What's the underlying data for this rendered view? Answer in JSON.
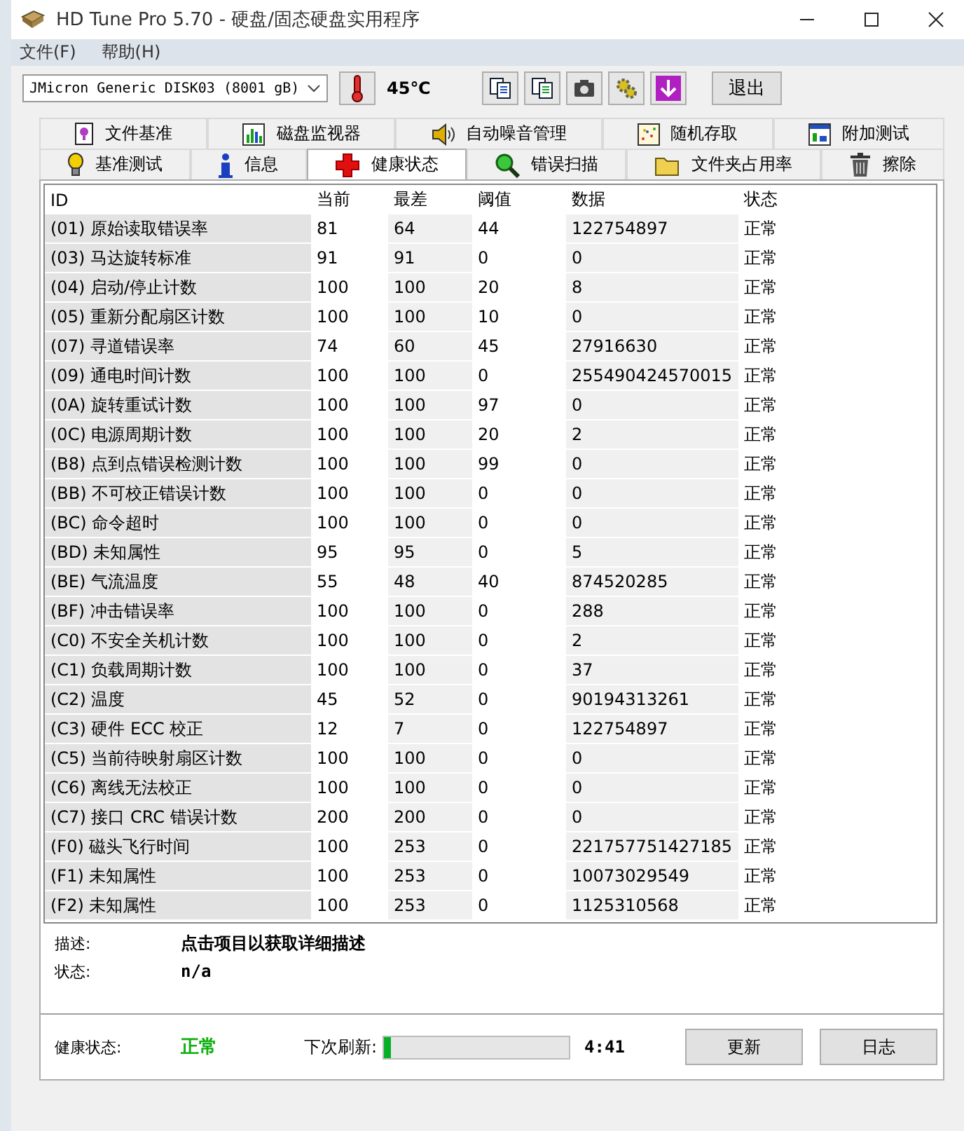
{
  "window": {
    "title": "HD Tune Pro 5.70 - 硬盘/固态硬盘实用程序"
  },
  "menu": [
    "文件(F)",
    "帮助(H)"
  ],
  "toolbar": {
    "drive": "JMicron Generic DISK03 (8001 gB)",
    "temperature": "45℃",
    "exit_button": "退出"
  },
  "tabs_top": [
    {
      "label": "文件基准",
      "selected": false
    },
    {
      "label": "磁盘监视器",
      "selected": false
    },
    {
      "label": "自动噪音管理",
      "selected": false
    },
    {
      "label": "随机存取",
      "selected": false
    },
    {
      "label": "附加测试",
      "selected": false
    }
  ],
  "tabs_bottom": [
    {
      "label": "基准测试",
      "selected": false
    },
    {
      "label": "信息",
      "selected": false
    },
    {
      "label": "健康状态",
      "selected": true
    },
    {
      "label": "错误扫描",
      "selected": false
    },
    {
      "label": "文件夹占用率",
      "selected": false
    },
    {
      "label": "擦除",
      "selected": false
    }
  ],
  "table": {
    "columns": [
      "ID",
      "当前",
      "最差",
      "阈值",
      "数据",
      "状态"
    ],
    "rows": [
      [
        "(01) 原始读取错误率",
        "81",
        "64",
        "44",
        "122754897",
        "正常"
      ],
      [
        "(03) 马达旋转标准",
        "91",
        "91",
        "0",
        "0",
        "正常"
      ],
      [
        "(04) 启动/停止计数",
        "100",
        "100",
        "20",
        "8",
        "正常"
      ],
      [
        "(05) 重新分配扇区计数",
        "100",
        "100",
        "10",
        "0",
        "正常"
      ],
      [
        "(07) 寻道错误率",
        "74",
        "60",
        "45",
        "27916630",
        "正常"
      ],
      [
        "(09) 通电时间计数",
        "100",
        "100",
        "0",
        "255490424570015",
        "正常"
      ],
      [
        "(0A) 旋转重试计数",
        "100",
        "100",
        "97",
        "0",
        "正常"
      ],
      [
        "(0C) 电源周期计数",
        "100",
        "100",
        "20",
        "2",
        "正常"
      ],
      [
        "(B8) 点到点错误检测计数",
        "100",
        "100",
        "99",
        "0",
        "正常"
      ],
      [
        "(BB) 不可校正错误计数",
        "100",
        "100",
        "0",
        "0",
        "正常"
      ],
      [
        "(BC) 命令超时",
        "100",
        "100",
        "0",
        "0",
        "正常"
      ],
      [
        "(BD) 未知属性",
        "95",
        "95",
        "0",
        "5",
        "正常"
      ],
      [
        "(BE) 气流温度",
        "55",
        "48",
        "40",
        "874520285",
        "正常"
      ],
      [
        "(BF) 冲击错误率",
        "100",
        "100",
        "0",
        "288",
        "正常"
      ],
      [
        "(C0) 不安全关机计数",
        "100",
        "100",
        "0",
        "2",
        "正常"
      ],
      [
        "(C1) 负载周期计数",
        "100",
        "100",
        "0",
        "37",
        "正常"
      ],
      [
        "(C2) 温度",
        "45",
        "52",
        "0",
        "90194313261",
        "正常"
      ],
      [
        "(C3) 硬件 ECC 校正",
        "12",
        "7",
        "0",
        "122754897",
        "正常"
      ],
      [
        "(C5) 当前待映射扇区计数",
        "100",
        "100",
        "0",
        "0",
        "正常"
      ],
      [
        "(C6) 离线无法校正",
        "100",
        "100",
        "0",
        "0",
        "正常"
      ],
      [
        "(C7) 接口 CRC 错误计数",
        "200",
        "200",
        "0",
        "0",
        "正常"
      ],
      [
        "(F0) 磁头飞行时间",
        "100",
        "253",
        "0",
        "221757751427185",
        "正常"
      ],
      [
        "(F1) 未知属性",
        "100",
        "253",
        "0",
        "10073029549",
        "正常"
      ],
      [
        "(F2) 未知属性",
        "100",
        "253",
        "0",
        "1125310568",
        "正常"
      ]
    ]
  },
  "details": {
    "description_label": "描述:",
    "description": "点击项目以获取详细描述",
    "status_label": "状态:",
    "status": "n/a"
  },
  "footer": {
    "health_label": "健康状态:",
    "health": "正常",
    "refresh_label": "下次刷新:",
    "refresh": {
      "level": 0.04
    },
    "countdown": "4:41",
    "buttons": [
      "更新",
      "日志"
    ]
  }
}
